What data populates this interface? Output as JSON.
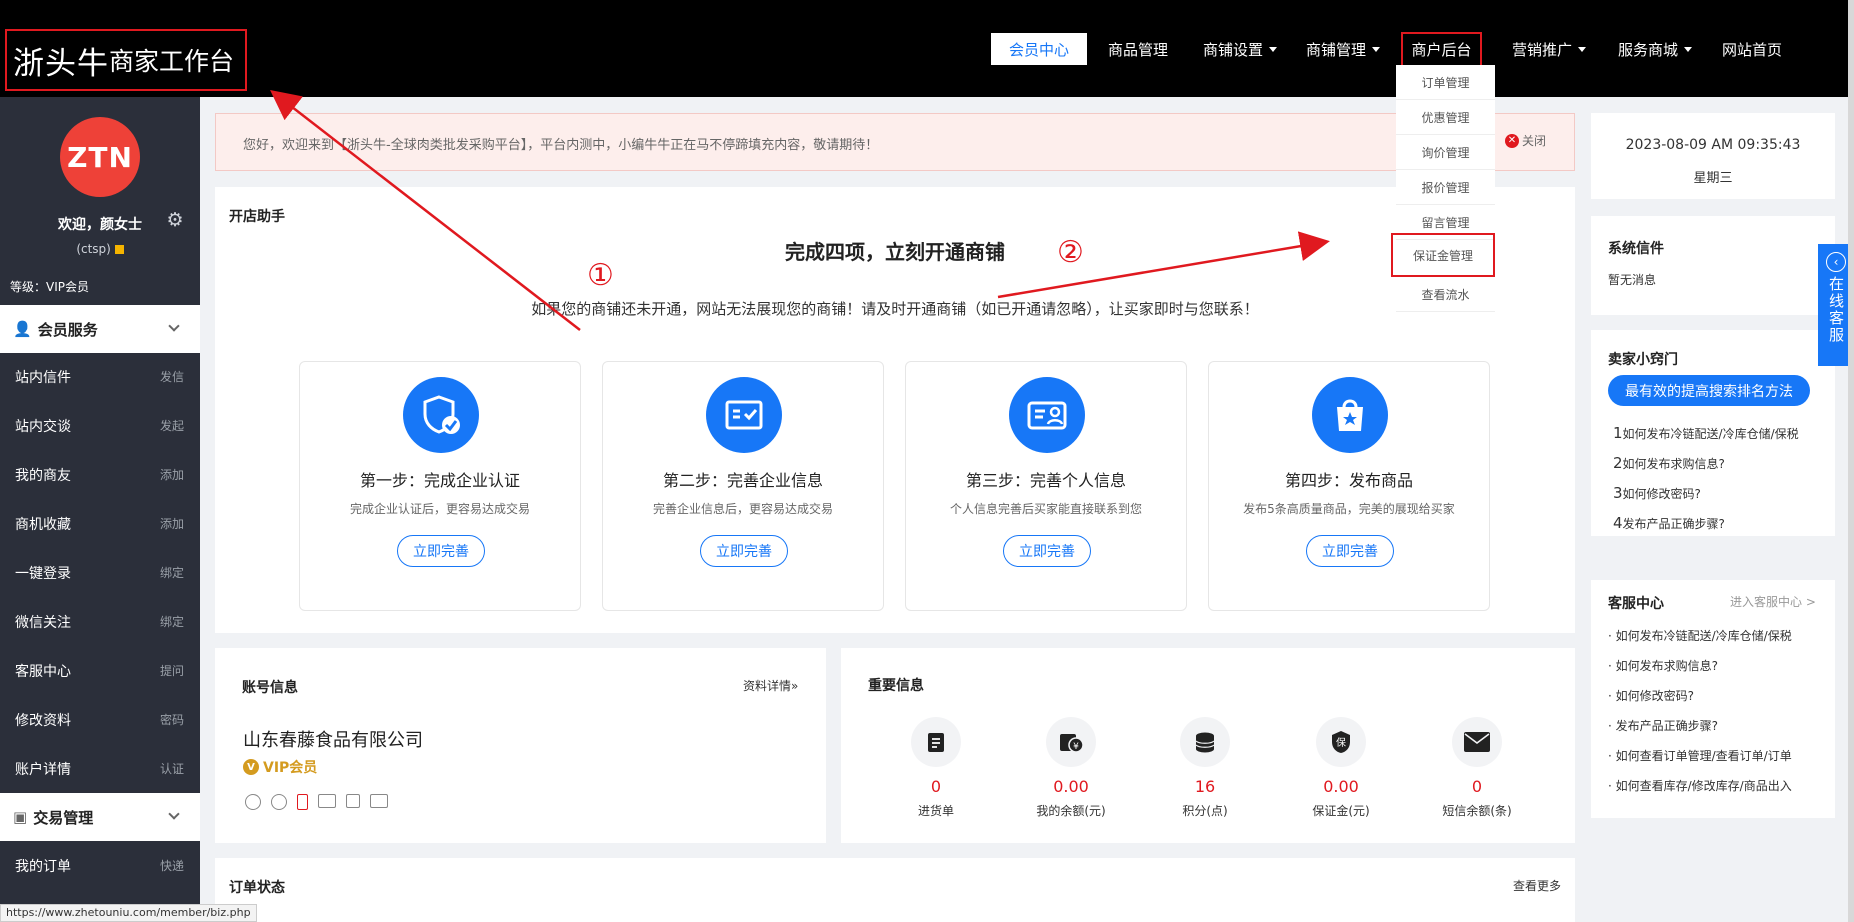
{
  "header": {
    "logo_big": "浙头牛",
    "logo_small": "商家工作台",
    "nav": [
      {
        "label": "会员中心"
      },
      {
        "label": "商品管理"
      },
      {
        "label": "商铺设置"
      },
      {
        "label": "商铺管理"
      },
      {
        "label": "商户后台"
      },
      {
        "label": "营销推广"
      },
      {
        "label": "服务商城"
      },
      {
        "label": "网站首页"
      }
    ],
    "dropdown": [
      {
        "label": "订单管理"
      },
      {
        "label": "优惠管理"
      },
      {
        "label": "询价管理"
      },
      {
        "label": "报价管理"
      },
      {
        "label": "留言管理"
      },
      {
        "label": "保证金管理"
      },
      {
        "label": "查看流水"
      }
    ]
  },
  "sidebar": {
    "avatar_text": "ZTN",
    "welcome": "欢迎，颜女士",
    "account": "(ctsp)",
    "level": "等级：VIP会员",
    "section1": "会员服务",
    "items": [
      {
        "label": "站内信件",
        "action": "发信"
      },
      {
        "label": "站内交谈",
        "action": "发起"
      },
      {
        "label": "我的商友",
        "action": "添加"
      },
      {
        "label": "商机收藏",
        "action": "添加"
      },
      {
        "label": "一键登录",
        "action": "绑定"
      },
      {
        "label": "微信关注",
        "action": "绑定"
      },
      {
        "label": "客服中心",
        "action": "提问"
      },
      {
        "label": "修改资料",
        "action": "密码"
      },
      {
        "label": "账户详情",
        "action": "认证"
      }
    ],
    "section2": "交易管理",
    "items2": [
      {
        "label": "我的订单",
        "action": "快递"
      }
    ]
  },
  "notice": {
    "text": "您好，欢迎来到【浙头牛-全球肉类批发采购平台】，平台内测中，小编牛牛正在马不停蹄填充内容，敬请期待！",
    "close": "关闭"
  },
  "assistant": {
    "title": "开店助手",
    "headline": "完成四项，立刻开通商铺",
    "sub": "如果您的商铺还未开通，网站无法展现您的商铺！请及时开通商铺（如已开通请忽略），让买家即时与您联系！",
    "steps": [
      {
        "title": "第一步：完成企业认证",
        "desc": "完成企业认证后，更容易达成交易",
        "btn": "立即完善",
        "icon": "shield-check-icon"
      },
      {
        "title": "第二步：完善企业信息",
        "desc": "完善企业信息后，更容易达成交易",
        "btn": "立即完善",
        "icon": "certificate-icon"
      },
      {
        "title": "第三步：完善个人信息",
        "desc": "个人信息完善后买家能直接联系到您",
        "btn": "立即完善",
        "icon": "id-card-icon"
      },
      {
        "title": "第四步：发布商品",
        "desc": "发布5条高质量商品，完美的展现给买家",
        "btn": "立即完善",
        "icon": "shopping-bag-star-icon"
      }
    ]
  },
  "account": {
    "title": "账号信息",
    "more": "资料详情»",
    "company": "山东春藤食品有限公司",
    "vip": "VIP会员"
  },
  "important": {
    "title": "重要信息",
    "items": [
      {
        "value": "0",
        "label": "进货单",
        "icon": "clipboard-icon"
      },
      {
        "value": "0.00",
        "label": "我的余额(元)",
        "icon": "wallet-yen-icon"
      },
      {
        "value": "16",
        "label": "积分(点)",
        "icon": "coins-stack-icon"
      },
      {
        "value": "0.00",
        "label": "保证金(元)",
        "icon": "deposit-shield-icon"
      },
      {
        "value": "0",
        "label": "短信余额(条)",
        "icon": "envelope-icon"
      }
    ]
  },
  "orders": {
    "title": "订单状态",
    "more": "查看更多"
  },
  "right": {
    "datetime": "2023-08-09 AM 09:35:43",
    "weekday": "星期三",
    "mail_title": "系统信件",
    "mail_empty": "暂无消息",
    "tips_title": "卖家小窍门",
    "tips_button": "最有效的提高搜索排名方法",
    "tips": [
      {
        "num": "1",
        "text": "如何发布冷链配送/冷库仓储/保税"
      },
      {
        "num": "2",
        "text": "如何发布求购信息?"
      },
      {
        "num": "3",
        "text": "如何修改密码?"
      },
      {
        "num": "4",
        "text": "发布产品正确步骤?"
      }
    ],
    "cs_title": "客服中心",
    "cs_more": "进入客服中心 >",
    "cs_links": [
      "· 如何发布冷链配送/冷库仓储/保税",
      "· 如何发布求购信息?",
      "· 如何修改密码?",
      "· 发布产品正确步骤?",
      "· 如何查看订单管理/查看订单/订单",
      "· 如何查看库存/修改库存/商品出入"
    ],
    "online": "在线客服"
  },
  "annotations": {
    "one": "①",
    "two": "②"
  },
  "status_url": "https://www.zhetouniu.com/member/biz.php",
  "colors": {
    "accent": "#1777f7",
    "highlight": "#e0191f",
    "sidebar": "#2b2f3a"
  }
}
